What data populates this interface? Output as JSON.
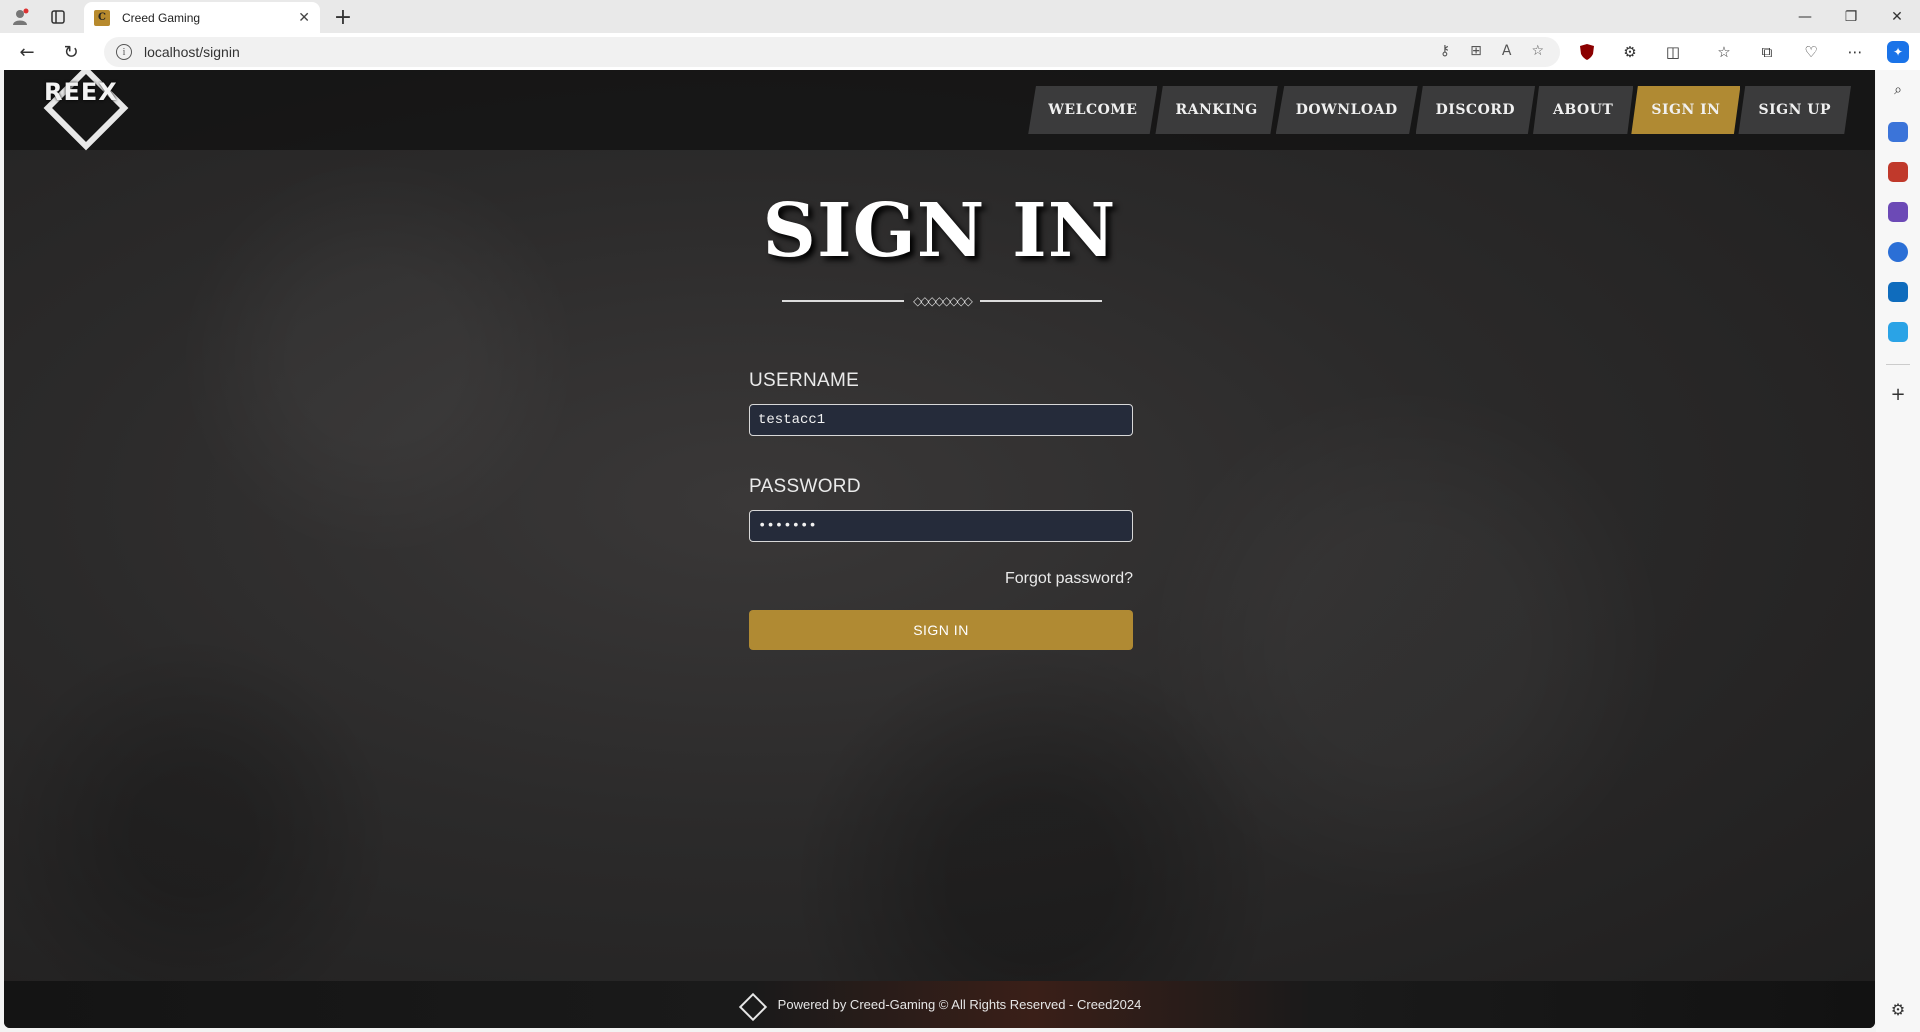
{
  "browser": {
    "tab_title": "Creed Gaming",
    "url": "localhost/signin",
    "favicon_letter": "C"
  },
  "site": {
    "logo_text": "REEX",
    "nav": [
      {
        "label": "WELCOME",
        "active": false
      },
      {
        "label": "RANKING",
        "active": false
      },
      {
        "label": "DOWNLOAD",
        "active": false
      },
      {
        "label": "DISCORD",
        "active": false
      },
      {
        "label": "ABOUT",
        "active": false
      },
      {
        "label": "SIGN IN",
        "active": true
      },
      {
        "label": "SIGN UP",
        "active": false
      }
    ],
    "accent_color": "#b08a33",
    "title": "SIGN IN",
    "divider_ornament": "◇◇◇◇◇◇◇◇",
    "form": {
      "username_label": "USERNAME",
      "username_value": "testacc1",
      "password_label": "PASSWORD",
      "password_value": "•••••••",
      "forgot_label": "Forgot password?",
      "submit_label": "SIGN IN"
    },
    "footer_text": "Powered by Creed-Gaming © All Rights Reserved - Creed2024"
  }
}
